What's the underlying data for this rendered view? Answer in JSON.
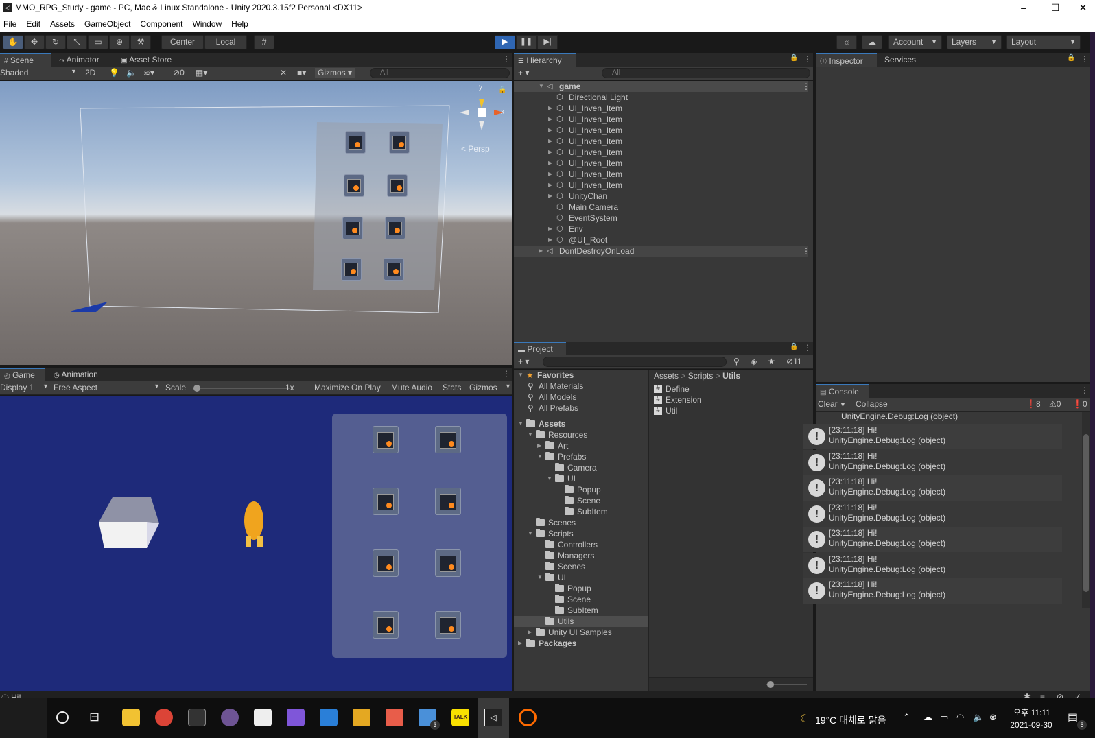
{
  "window": {
    "title": "MMO_RPG_Study - game - PC, Mac & Linux Standalone - Unity 2020.3.15f2 Personal <DX11>",
    "minimize": "–",
    "maximize": "☐",
    "close": "✕"
  },
  "menu": [
    "File",
    "Edit",
    "Assets",
    "GameObject",
    "Component",
    "Window",
    "Help"
  ],
  "toolbar": {
    "center_label": "Center",
    "local_label": "Local",
    "account_label": "Account",
    "layers_label": "Layers",
    "layout_label": "Layout"
  },
  "scene": {
    "tabs": [
      "Scene",
      "Animator",
      "Asset Store"
    ],
    "shading": "Shaded",
    "mode_2d": "2D",
    "hidden_count": "0",
    "gizmos": "Gizmos",
    "search_placeholder": "All",
    "persp_label": "Persp",
    "gizmo_y": "y",
    "gizmo_x": "x"
  },
  "game": {
    "tabs": [
      "Game",
      "Animation"
    ],
    "display": "Display 1",
    "aspect": "Free Aspect",
    "scale_label": "Scale",
    "scale_value": "1x",
    "maximize_on_play": "Maximize On Play",
    "mute_audio": "Mute Audio",
    "stats": "Stats",
    "gizmos": "Gizmos"
  },
  "hierarchy": {
    "tab": "Hierarchy",
    "search_placeholder": "All",
    "scene_name": "game",
    "items": [
      {
        "label": "Directional Light",
        "expandable": false
      },
      {
        "label": "UI_Inven_Item",
        "expandable": true
      },
      {
        "label": "UI_Inven_Item",
        "expandable": true
      },
      {
        "label": "UI_Inven_Item",
        "expandable": true
      },
      {
        "label": "UI_Inven_Item",
        "expandable": true
      },
      {
        "label": "UI_Inven_Item",
        "expandable": true
      },
      {
        "label": "UI_Inven_Item",
        "expandable": true
      },
      {
        "label": "UI_Inven_Item",
        "expandable": true
      },
      {
        "label": "UI_Inven_Item",
        "expandable": true
      },
      {
        "label": "UnityChan",
        "expandable": true
      },
      {
        "label": "Main Camera",
        "expandable": false
      },
      {
        "label": "EventSystem",
        "expandable": false
      },
      {
        "label": "Env",
        "expandable": true
      },
      {
        "label": "@UI_Root",
        "expandable": true
      }
    ],
    "dont_destroy": "DontDestroyOnLoad"
  },
  "inspector": {
    "tabs": [
      "Inspector",
      "Services"
    ]
  },
  "project": {
    "tab": "Project",
    "hidden_count": "11",
    "favorites_label": "Favorites",
    "favorites": [
      "All Materials",
      "All Models",
      "All Prefabs"
    ],
    "tree": [
      {
        "label": "Assets",
        "depth": 0,
        "arrow": "open",
        "bold": true
      },
      {
        "label": "Resources",
        "depth": 1,
        "arrow": "open"
      },
      {
        "label": "Art",
        "depth": 2,
        "arrow": "closed"
      },
      {
        "label": "Prefabs",
        "depth": 2,
        "arrow": "open"
      },
      {
        "label": "Camera",
        "depth": 3,
        "arrow": "none"
      },
      {
        "label": "UI",
        "depth": 3,
        "arrow": "open"
      },
      {
        "label": "Popup",
        "depth": 4,
        "arrow": "none"
      },
      {
        "label": "Scene",
        "depth": 4,
        "arrow": "none"
      },
      {
        "label": "SubItem",
        "depth": 4,
        "arrow": "none"
      },
      {
        "label": "Scenes",
        "depth": 1,
        "arrow": "none"
      },
      {
        "label": "Scripts",
        "depth": 1,
        "arrow": "open"
      },
      {
        "label": "Controllers",
        "depth": 2,
        "arrow": "none"
      },
      {
        "label": "Managers",
        "depth": 2,
        "arrow": "none"
      },
      {
        "label": "Scenes",
        "depth": 2,
        "arrow": "none"
      },
      {
        "label": "UI",
        "depth": 2,
        "arrow": "open"
      },
      {
        "label": "Popup",
        "depth": 3,
        "arrow": "none"
      },
      {
        "label": "Scene",
        "depth": 3,
        "arrow": "none"
      },
      {
        "label": "SubItem",
        "depth": 3,
        "arrow": "none"
      },
      {
        "label": "Utils",
        "depth": 2,
        "arrow": "none",
        "selected": true
      },
      {
        "label": "Unity UI Samples",
        "depth": 1,
        "arrow": "closed"
      },
      {
        "label": "Packages",
        "depth": 0,
        "arrow": "closed",
        "bold": true
      }
    ],
    "breadcrumb": [
      "Assets",
      "Scripts",
      "Utils"
    ],
    "files": [
      "Define",
      "Extension",
      "Util"
    ]
  },
  "console": {
    "tab": "Console",
    "clear": "Clear",
    "collapse": "Collapse",
    "info_count": "8",
    "warn_count": "0",
    "error_count": "0",
    "first_line": "UnityEngine.Debug:Log (object)",
    "entries": [
      {
        "time": "[23:11:18] Hi!",
        "source": "UnityEngine.Debug:Log (object)"
      },
      {
        "time": "[23:11:18] Hi!",
        "source": "UnityEngine.Debug:Log (object)"
      },
      {
        "time": "[23:11:18] Hi!",
        "source": "UnityEngine.Debug:Log (object)"
      },
      {
        "time": "[23:11:18] Hi!",
        "source": "UnityEngine.Debug:Log (object)"
      },
      {
        "time": "[23:11:18] Hi!",
        "source": "UnityEngine.Debug:Log (object)"
      },
      {
        "time": "[23:11:18] Hi!",
        "source": "UnityEngine.Debug:Log (object)"
      },
      {
        "time": "[23:11:18] Hi!",
        "source": "UnityEngine.Debug:Log (object)"
      }
    ]
  },
  "statusbar": {
    "message": "Hi!"
  },
  "taskbar": {
    "weather": "19°C  대체로 맑음",
    "time": "오후 11:11",
    "date": "2021-09-30",
    "notification_count": "5",
    "todo_badge": "3",
    "talk_label": "TALK"
  },
  "colors": {
    "accent": "#3a79bb",
    "play_active": "#2f66b3",
    "game_bg": "#1e2a7a",
    "taskbar": "#0e0e0e"
  }
}
